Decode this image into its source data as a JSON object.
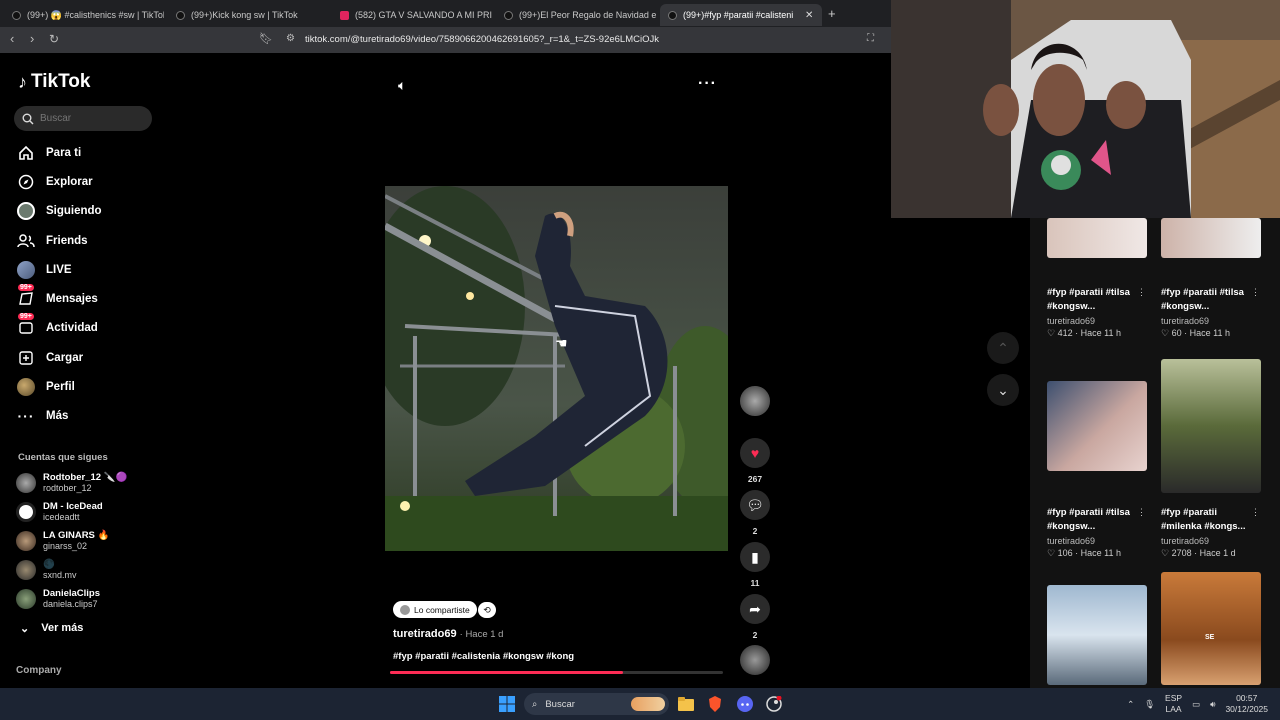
{
  "browser": {
    "tabs": [
      {
        "label": "(99+) 😱 #calisthenics #sw | TikTok",
        "active": false
      },
      {
        "label": "(99+)Kick kong sw | TikTok",
        "active": false
      },
      {
        "label": "(582) GTA V SALVANDO A MI PRIMO",
        "active": false
      },
      {
        "label": "(99+)El Peor Regalo de Navidad en e",
        "active": false
      },
      {
        "label": "(99+)#fyp #paratii #calistenia #",
        "active": true
      }
    ],
    "new_tab": "+",
    "close_tab": "✕",
    "url": "tiktok.com/@turetirado69/video/7589066200462691605?_r=1&_t=ZS-92e6LMCiOJk"
  },
  "sidebar": {
    "logo_text": "TikTok",
    "search_placeholder": "Buscar",
    "nav": [
      {
        "label": "Para ti",
        "icon": "home-icon"
      },
      {
        "label": "Explorar",
        "icon": "compass-icon"
      },
      {
        "label": "Siguiendo",
        "icon": "following-icon"
      },
      {
        "label": "Friends",
        "icon": "friends-icon"
      },
      {
        "label": "LIVE",
        "icon": "live-icon"
      },
      {
        "label": "Mensajes",
        "icon": "messages-icon",
        "badge": "99+"
      },
      {
        "label": "Actividad",
        "icon": "activity-icon",
        "badge": "99+"
      },
      {
        "label": "Cargar",
        "icon": "upload-icon"
      },
      {
        "label": "Perfil",
        "icon": "profile-icon"
      },
      {
        "label": "Más",
        "icon": "more-icon"
      }
    ],
    "following_title": "Cuentas que sigues",
    "accounts": [
      {
        "name": "Rodtober_12 🔪🟣",
        "handle": "rodtober_12"
      },
      {
        "name": "DM - IceDead",
        "handle": "icedeadtt"
      },
      {
        "name": "LA GINARS 🔥",
        "handle": "ginarss_02"
      },
      {
        "name": "🌑",
        "handle": "sxnd.mv"
      },
      {
        "name": "DanielaClips",
        "handle": "daniela.clips7"
      }
    ],
    "see_more": "Ver más",
    "company": "Company"
  },
  "video": {
    "shared_label": "Lo compartiste",
    "author": "turetirado69",
    "time": "· Hace 1 d",
    "hashtags": "#fyp #paratii #calistenia #kongsw #kong",
    "progress": 0.7,
    "likes": "267",
    "comments": "2",
    "saves": "11",
    "shares": "2"
  },
  "related": [
    {
      "title": "#fyp #paratii #tilsa #kongsw...",
      "author": "turetirado69",
      "likes": "412",
      "time": "Hace 11 h"
    },
    {
      "title": "#fyp #paratii #tilsa #kongsw...",
      "author": "turetirado69",
      "likes": "60",
      "time": "Hace 11 h"
    },
    {
      "title": "#fyp #paratii #tilsa #kongsw...",
      "author": "turetirado69",
      "likes": "106",
      "time": "Hace 11 h"
    },
    {
      "title": "#fyp #paratii #milenka #kongs...",
      "author": "turetirado69",
      "likes": "2708",
      "time": "Hace 1 d"
    }
  ],
  "thumb_text": {
    "card5": "SE"
  },
  "taskbar": {
    "search": "Buscar",
    "lang": "ESP",
    "lang2": "LAA",
    "time": "00:57",
    "date": "30/12/2025"
  },
  "colors": {
    "accent": "#fe2c55",
    "bg": "#000000",
    "panel": "#121212"
  }
}
